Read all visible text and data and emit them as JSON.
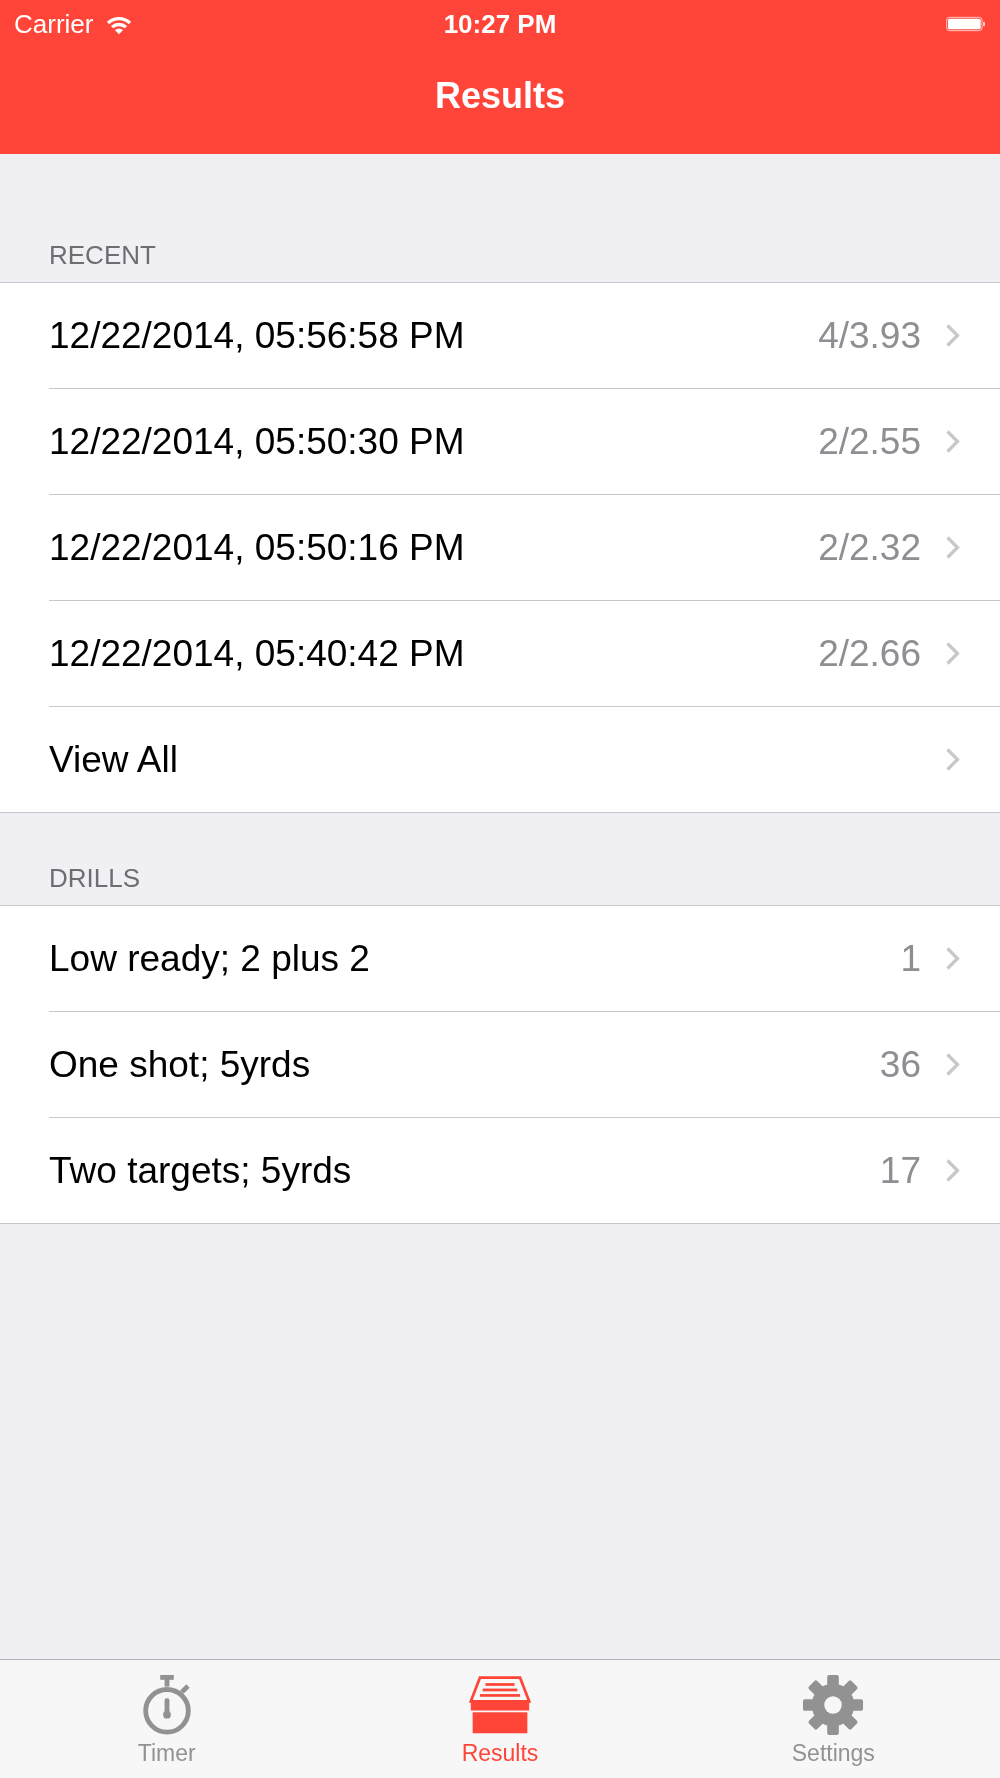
{
  "status_bar": {
    "carrier": "Carrier",
    "time": "10:27 PM"
  },
  "nav_bar": {
    "title": "Results"
  },
  "sections": [
    {
      "header": "RECENT",
      "rows": [
        {
          "label": "12/22/2014, 05:56:58 PM",
          "detail": "4/3.93"
        },
        {
          "label": "12/22/2014, 05:50:30 PM",
          "detail": "2/2.55"
        },
        {
          "label": "12/22/2014, 05:50:16 PM",
          "detail": "2/2.32"
        },
        {
          "label": "12/22/2014, 05:40:42 PM",
          "detail": "2/2.66"
        },
        {
          "label": "View All"
        }
      ]
    },
    {
      "header": "DRILLS",
      "rows": [
        {
          "label": "Low ready; 2 plus 2",
          "detail": "1"
        },
        {
          "label": "One shot; 5yrds",
          "detail": "36"
        },
        {
          "label": "Two targets; 5yrds",
          "detail": "17"
        }
      ]
    }
  ],
  "tab_bar": [
    {
      "kind": "timer",
      "label": "Timer",
      "selected": false
    },
    {
      "kind": "results",
      "label": "Results",
      "selected": true
    },
    {
      "kind": "settings",
      "label": "Settings",
      "selected": false
    }
  ]
}
